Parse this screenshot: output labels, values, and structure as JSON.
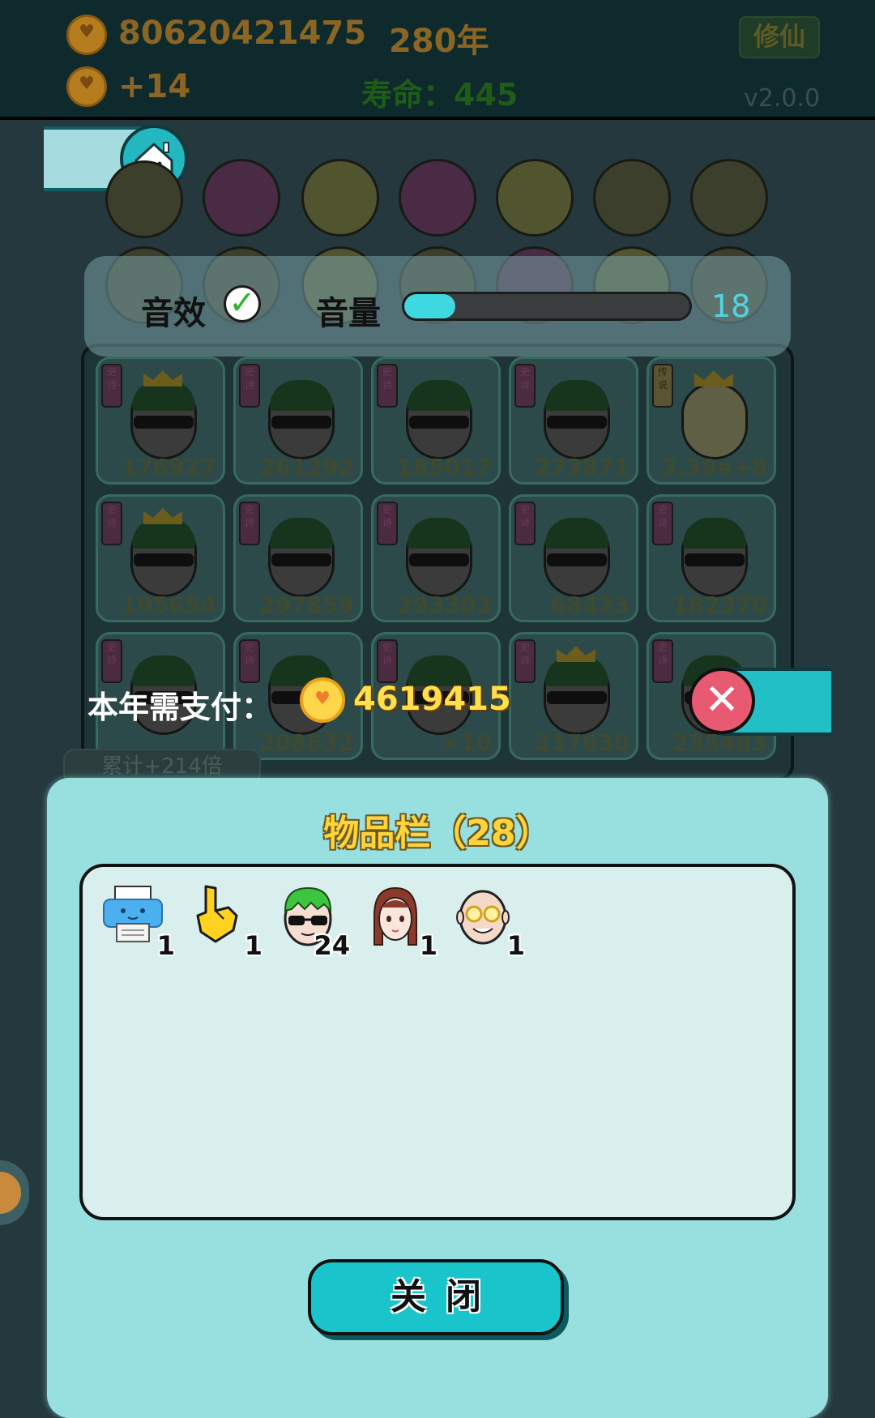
{
  "topbar": {
    "coins": "80620421475",
    "years": "280年",
    "income": "+14",
    "lifespan": "寿命：445",
    "cultivate_label": "修仙",
    "version": "v2.0.0"
  },
  "settings": {
    "sound_label": "音效",
    "sound_enabled": true,
    "volume_label": "音量",
    "volume_value": "18",
    "volume_percent": 18
  },
  "board": {
    "cells": [
      {
        "tag": "史诗",
        "value": "176927",
        "crown": true
      },
      {
        "tag": "史诗",
        "value": "261292",
        "crown": false
      },
      {
        "tag": "史诗",
        "value": "185017",
        "crown": false
      },
      {
        "tag": "史诗",
        "value": "273871",
        "crown": false
      },
      {
        "tag": "传说",
        "value": "3.39e+8",
        "crown": true
      },
      {
        "tag": "史诗",
        "value": "195654",
        "crown": true
      },
      {
        "tag": "史诗",
        "value": "297859",
        "crown": false
      },
      {
        "tag": "史诗",
        "value": "293303",
        "crown": false
      },
      {
        "tag": "史诗",
        "value": "68423",
        "crown": false
      },
      {
        "tag": "史诗",
        "value": "182370",
        "crown": false
      },
      {
        "tag": "史诗",
        "value": "",
        "crown": false
      },
      {
        "tag": "史诗",
        "value": "208632",
        "crown": false
      },
      {
        "tag": "史诗",
        "value": "×10",
        "crown": false
      },
      {
        "tag": "史诗",
        "value": "217630",
        "crown": true
      },
      {
        "tag": "史诗",
        "value": "235483",
        "crown": false
      }
    ],
    "multiplier": "累计+214倍"
  },
  "payment": {
    "label": "本年需支付：",
    "amount": "4619415"
  },
  "inventory": {
    "title": "物品栏（28）",
    "items": [
      {
        "icon": "printer-icon",
        "count": "1"
      },
      {
        "icon": "pointing-hand-icon",
        "count": "1"
      },
      {
        "icon": "green-hair-man-icon",
        "count": "24"
      },
      {
        "icon": "girl-avatar-icon",
        "count": "1"
      },
      {
        "icon": "old-man-avatar-icon",
        "count": "1"
      }
    ],
    "close_label": "关闭"
  },
  "colors": {
    "accent": "#19c4cb",
    "panel": "#98e0e0",
    "gold": "#ffd33a"
  }
}
